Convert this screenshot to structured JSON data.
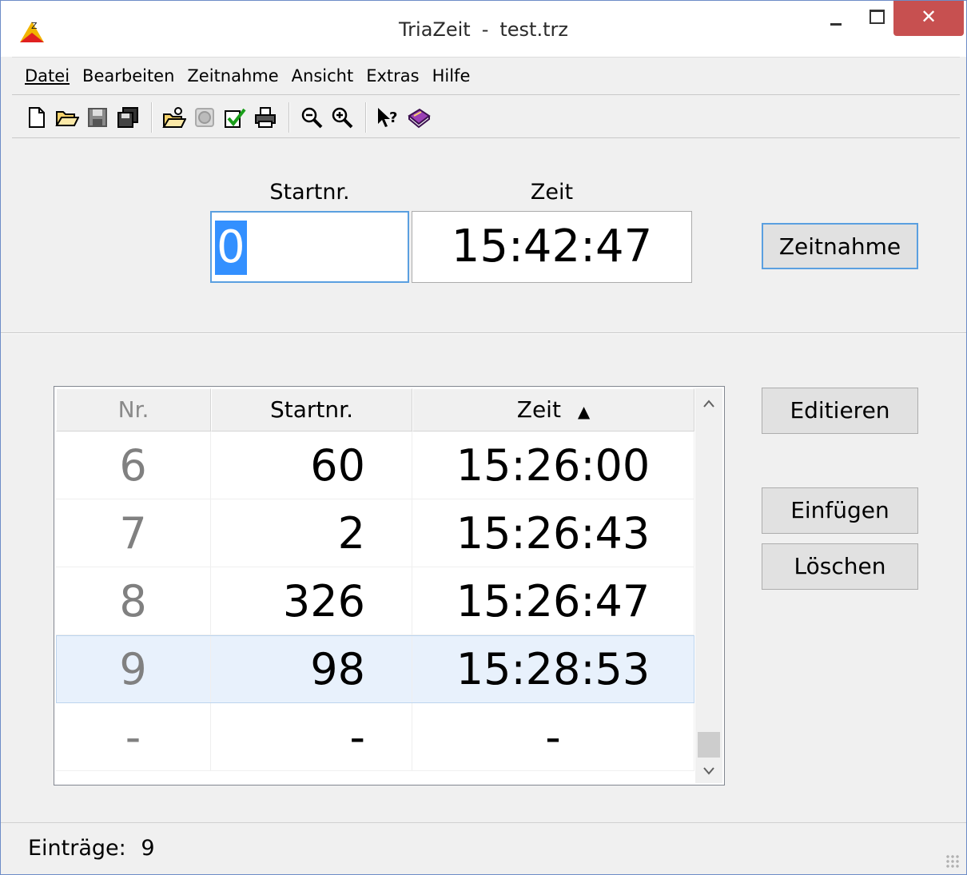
{
  "window": {
    "app_name": "TriaZeit",
    "separator": "-",
    "file_name": "test.trz"
  },
  "menu": [
    "Datei",
    "Bearbeiten",
    "Zeitnahme",
    "Ansicht",
    "Extras",
    "Hilfe"
  ],
  "toolbar": {
    "icons": [
      "new-file-icon",
      "open-folder-icon",
      "save-icon",
      "save-all-icon",
      "import-icon",
      "disc-icon",
      "check-list-icon",
      "print-icon",
      "zoom-out-icon",
      "zoom-in-icon",
      "help-pointer-icon",
      "book-icon"
    ]
  },
  "entry": {
    "startnr_label": "Startnr.",
    "zeit_label": "Zeit",
    "startnr_value": "0",
    "zeit_value": "15:42:47",
    "button_label": "Zeitnahme"
  },
  "table": {
    "headers": {
      "nr": "Nr.",
      "startnr": "Startnr.",
      "zeit": "Zeit"
    },
    "sort_indicator": "▲",
    "rows": [
      {
        "nr": "6",
        "startnr": "60",
        "zeit": "15:26:00",
        "selected": false
      },
      {
        "nr": "7",
        "startnr": "2",
        "zeit": "15:26:43",
        "selected": false
      },
      {
        "nr": "8",
        "startnr": "326",
        "zeit": "15:26:47",
        "selected": false
      },
      {
        "nr": "9",
        "startnr": "98",
        "zeit": "15:28:53",
        "selected": true
      },
      {
        "nr": "-",
        "startnr": "-",
        "zeit": "-",
        "selected": false
      }
    ]
  },
  "actions": {
    "edit": "Editieren",
    "insert": "Einfügen",
    "delete": "Löschen"
  },
  "status": {
    "label": "Einträge:",
    "count": "9"
  },
  "colors": {
    "selection": "#3390ff",
    "focus_border": "#5a9fe0",
    "close_button": "#c75050",
    "selected_row": "#e8f1fc"
  }
}
